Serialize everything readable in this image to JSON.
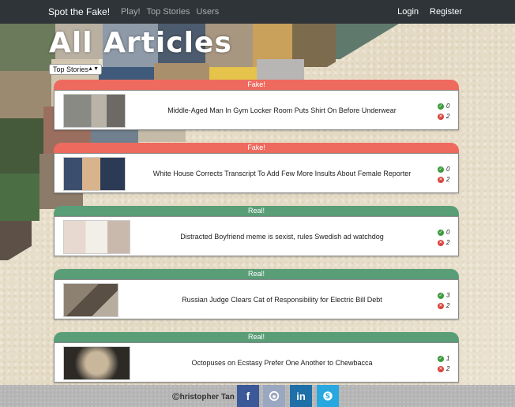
{
  "navbar": {
    "brand": "Spot the Fake!",
    "links": [
      "Play!",
      "Top Stories",
      "Users"
    ],
    "right_links": [
      "Login",
      "Register"
    ]
  },
  "page": {
    "title": "All Articles",
    "sort_select": {
      "value": "Top Stories"
    }
  },
  "articles": [
    {
      "label": "Fake!",
      "kind": "fake",
      "headline": "Middle-Aged Man In Gym Locker Room Puts Shirt On Before Underwear",
      "upvotes": "0",
      "downvotes": "2"
    },
    {
      "label": "Fake!",
      "kind": "fake",
      "headline": "White House Corrects Transcript To Add Few More Insults About Female Reporter",
      "upvotes": "0",
      "downvotes": "2"
    },
    {
      "label": "Real!",
      "kind": "real",
      "headline": "Distracted Boyfriend meme is sexist, rules Swedish ad watchdog",
      "upvotes": "0",
      "downvotes": "2"
    },
    {
      "label": "Real!",
      "kind": "real",
      "headline": "Russian Judge Clears Cat of Responsibility for Electric Bill Debt",
      "upvotes": "3",
      "downvotes": "2"
    },
    {
      "label": "Real!",
      "kind": "real",
      "headline": "Octopuses on Ecstasy Prefer One Another to Chewbacca",
      "upvotes": "1",
      "downvotes": "2"
    }
  ],
  "footer": {
    "copyright_symbol": "©",
    "author": "hristopher Tan",
    "social": [
      "facebook",
      "github",
      "linkedin",
      "skype"
    ]
  },
  "colors": {
    "navbar": "#2f3438",
    "fake": "#ef6a5e",
    "real": "#5a9e78"
  }
}
